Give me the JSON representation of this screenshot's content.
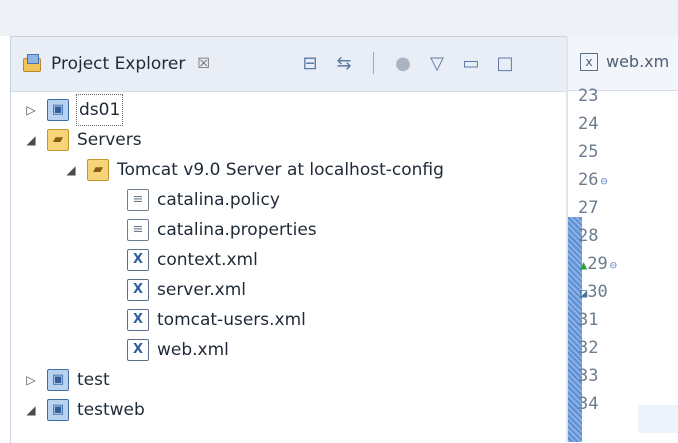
{
  "project_explorer": {
    "tab_label": "Project Explorer",
    "tab_close": "☒",
    "toolbar": {
      "collapse_all": "⊟",
      "link_with_editor": "⇆",
      "focus": "●",
      "view_menu": "▽",
      "minimize": "▭",
      "maximize": "□"
    },
    "tree": [
      {
        "indent": 0,
        "toggle": "▷",
        "icon": "project",
        "label": "ds01",
        "focused": true
      },
      {
        "indent": 0,
        "toggle": "◢",
        "icon": "folder",
        "label": "Servers"
      },
      {
        "indent": 1,
        "toggle": "◢",
        "icon": "folder",
        "label": "Tomcat v9.0 Server at localhost-config"
      },
      {
        "indent": 2,
        "toggle": "",
        "icon": "file",
        "label": "catalina.policy"
      },
      {
        "indent": 2,
        "toggle": "",
        "icon": "file",
        "label": "catalina.properties"
      },
      {
        "indent": 2,
        "toggle": "",
        "icon": "xml",
        "label": "context.xml"
      },
      {
        "indent": 2,
        "toggle": "",
        "icon": "xml",
        "label": "server.xml"
      },
      {
        "indent": 2,
        "toggle": "",
        "icon": "xml",
        "label": "tomcat-users.xml"
      },
      {
        "indent": 2,
        "toggle": "",
        "icon": "xml",
        "label": "web.xml"
      },
      {
        "indent": 0,
        "toggle": "▷",
        "icon": "project",
        "label": "test"
      },
      {
        "indent": 0,
        "toggle": "◢",
        "icon": "project",
        "label": "testweb"
      }
    ]
  },
  "editor": {
    "tab_label": "web.xm",
    "tab_icon_text": "x",
    "line_numbers": [
      "23",
      "24",
      "25",
      "26",
      "27",
      "28",
      "29",
      "30",
      "31",
      "32",
      "33",
      "34"
    ],
    "line_marks": {
      "26": "⊖",
      "29": "⊖"
    },
    "up_marker": "▲",
    "down_marker": "◪"
  }
}
